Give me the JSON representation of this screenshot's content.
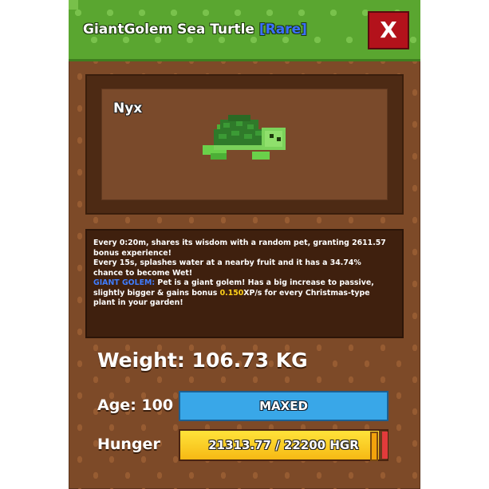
{
  "header": {
    "title": "GiantGolem Sea Turtle",
    "rarity": "[Rare]",
    "close_label": "X"
  },
  "pet": {
    "name": "Nyx",
    "icon": "sea-turtle-icon"
  },
  "description": {
    "line1": "Every 0:20m, shares its wisdom with a random pet, granting 2611.57",
    "line2": "bonus experience!",
    "line3": "Every 15s, splashes water at a nearby fruit and it has a 34.74%",
    "line4": "chance to become Wet!",
    "golem_tag": "GIANT GOLEM:",
    "line5_rest": " Pet is a giant golem! Has a big increase to passive,",
    "line6_pre": "slightly bigger & gains bonus ",
    "line6_value": "0.150",
    "line6_post": "XP/s for every Christmas-type",
    "line7": "plant in your garden!"
  },
  "stats": {
    "weight": "Weight: 106.73 KG",
    "age_label": "Age: 100",
    "age_status": "MAXED",
    "hunger_label": "Hunger",
    "hunger_text": "21313.77 / 22200 HGR",
    "hunger_fraction": 0.96
  },
  "colors": {
    "rarity": "#3b6fff",
    "close_button": "#b3121b",
    "age_bar": "#39a7e8",
    "hunger_bar": "#f6c51a"
  }
}
